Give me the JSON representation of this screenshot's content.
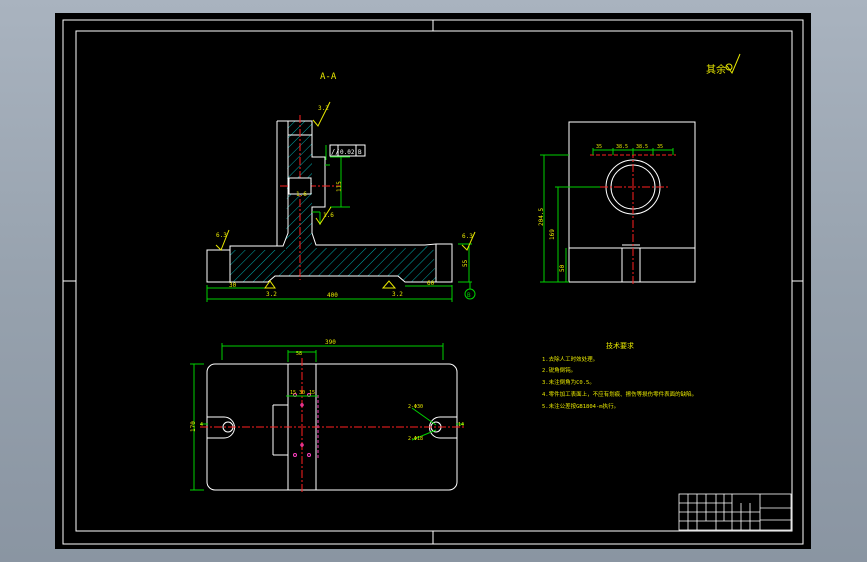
{
  "colors": {
    "background": "#000000",
    "outline": "#ffffff",
    "dimension": "#00d000",
    "centerline": "#ff2020",
    "hatch": "#00a8a8",
    "annotation": "#e8e800",
    "hole_mark": "#ff40c0"
  },
  "section_label": "A-A",
  "surface_finish_note": "其余",
  "roughness": {
    "top": "3.2",
    "left": "6.3",
    "right": "6.3",
    "inner": "1.6",
    "inner2": "1.6",
    "bottom_left": "3.2",
    "bottom_right": "3.2"
  },
  "tolerance": {
    "symbol": "//",
    "value": "0.02",
    "datum": "B"
  },
  "section_dims": {
    "overall_length": "400",
    "left_step": "30",
    "right_step": "60",
    "height_right": "55",
    "bore_height": "115",
    "datum_mark": "B"
  },
  "side_view_dims": {
    "overall_height": "204.5",
    "bore_center": "169",
    "base_height": "50",
    "top_dims": [
      "35",
      "38.5",
      "38.5",
      "35"
    ]
  },
  "plan_view_dims": {
    "overall_width": "390",
    "height": "170",
    "center_part": "58",
    "sub_a": "15",
    "sub_b": "30",
    "sub_c": "15",
    "slot_left": "4",
    "slot_right": "14",
    "hole_note_top": "2-Φ30",
    "hole_note_bottom": "2-Φ18"
  },
  "tech_requirements": {
    "title": "技术要求",
    "items": [
      "1.去除人工时效处理。",
      "2.锐角倒钝。",
      "3.未注倒角为C0.5。",
      "4.零件加工表面上，不应有划痕、擦伤等损伤零件表面的缺陷。",
      "5.未注公差按GB1804-m执行。"
    ]
  }
}
